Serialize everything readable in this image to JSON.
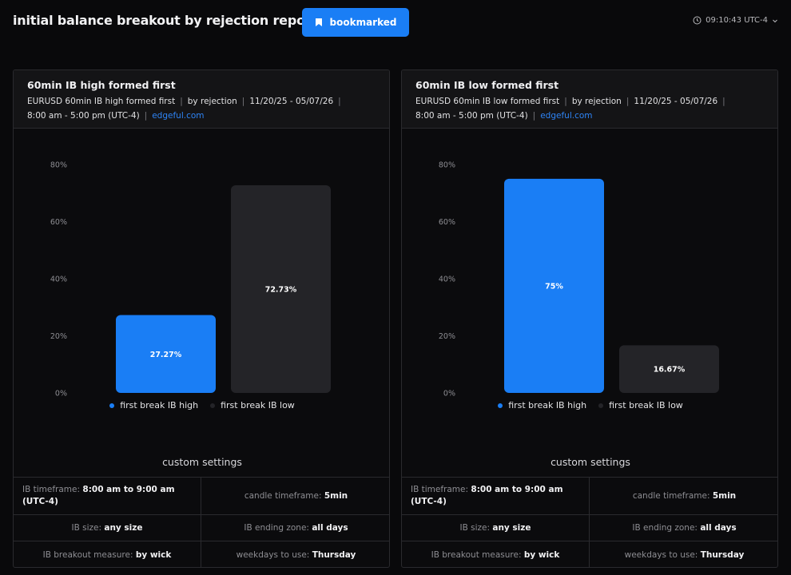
{
  "header": {
    "title": "initial balance breakout by rejection report",
    "bookmark_label": "bookmarked",
    "time": "09:10:43 UTC-4"
  },
  "cards": [
    {
      "title": "60min IB high formed first",
      "meta": {
        "subtitle": "EURUSD 60min IB high formed first",
        "by": "by rejection",
        "dates": "11/20/25 - 05/07/26",
        "hours": "8:00 am - 5:00 pm (UTC-4)",
        "link": "edgeful.com"
      },
      "legend": [
        "first break IB high",
        "first break IB low"
      ],
      "settings_title": "custom settings",
      "settings": [
        {
          "label": "IB timeframe:",
          "value": "8:00 am to 9:00 am (UTC-4)"
        },
        {
          "label": "candle timeframe:",
          "value": "5min"
        },
        {
          "label": "IB size:",
          "value": "any size"
        },
        {
          "label": "IB ending zone:",
          "value": "all days"
        },
        {
          "label": "IB breakout measure:",
          "value": "by wick"
        },
        {
          "label": "weekdays to use:",
          "value": "Thursday"
        }
      ]
    },
    {
      "title": "60min IB low formed first",
      "meta": {
        "subtitle": "EURUSD 60min IB low formed first",
        "by": "by rejection",
        "dates": "11/20/25 - 05/07/26",
        "hours": "8:00 am - 5:00 pm (UTC-4)",
        "link": "edgeful.com"
      },
      "legend": [
        "first break IB high",
        "first break IB low"
      ],
      "settings_title": "custom settings",
      "settings": [
        {
          "label": "IB timeframe:",
          "value": "8:00 am to 9:00 am (UTC-4)"
        },
        {
          "label": "candle timeframe:",
          "value": "5min"
        },
        {
          "label": "IB size:",
          "value": "any size"
        },
        {
          "label": "IB ending zone:",
          "value": "all days"
        },
        {
          "label": "IB breakout measure:",
          "value": "by wick"
        },
        {
          "label": "weekdays to use:",
          "value": "Thursday"
        }
      ]
    }
  ],
  "chart_data": [
    {
      "type": "bar",
      "categories": [
        "first break IB high",
        "first break IB low"
      ],
      "values": [
        27.27,
        72.73
      ],
      "labels": [
        "27.27%",
        "72.73%"
      ],
      "yticks": [
        "0%",
        "20%",
        "40%",
        "60%",
        "80%"
      ],
      "ylim": [
        0,
        80
      ],
      "colors": [
        "#1a7ef5",
        "#242428"
      ],
      "legend_position": "bottom"
    },
    {
      "type": "bar",
      "categories": [
        "first break IB high",
        "first break IB low"
      ],
      "values": [
        75,
        16.67
      ],
      "labels": [
        "75%",
        "16.67%"
      ],
      "yticks": [
        "0%",
        "20%",
        "40%",
        "60%",
        "80%"
      ],
      "ylim": [
        0,
        80
      ],
      "colors": [
        "#1a7ef5",
        "#242428"
      ],
      "legend_position": "bottom"
    }
  ]
}
